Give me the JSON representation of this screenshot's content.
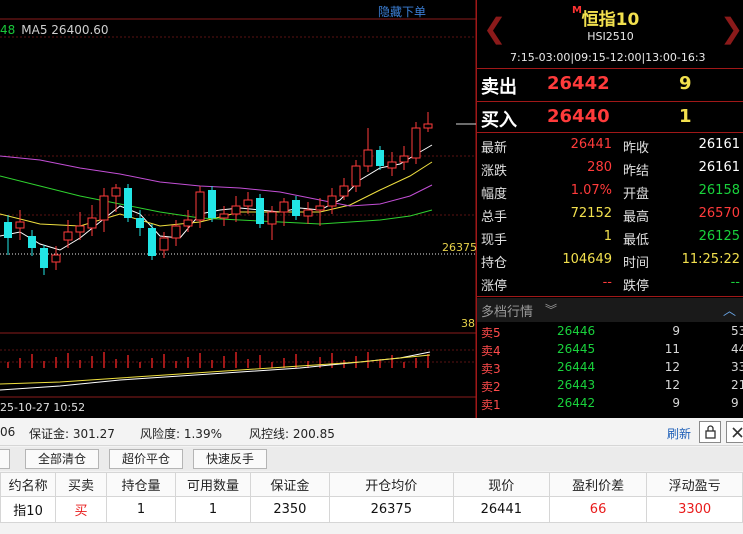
{
  "chart": {
    "hide_link": "隐藏下单",
    "ma_legend_num": "48",
    "ma_legend_text": "MA5 26400.60",
    "price_tag_main": "26375",
    "price_tag_sub": "38",
    "date_label": "25-10-27 10:52",
    "colors": {
      "up": "#ff3b3b",
      "down": "#22e6e6",
      "ma_white": "#ffffff",
      "ma_yellow": "#f0e040",
      "ma_purple": "#c34fd6",
      "ma_green": "#2fd12f"
    }
  },
  "quote": {
    "title": "恒指10",
    "market_flag": "M",
    "code": "HSI2510",
    "hours": "7:15-03:00|09:15-12:00|13:00-16:3",
    "sell": {
      "label": "卖出",
      "price": "26442",
      "volume": "9"
    },
    "buy": {
      "label": "买入",
      "price": "26440",
      "volume": "1"
    },
    "stats": [
      {
        "l1": "最新",
        "v1": "26441",
        "c1": "#ff3b3b",
        "l2": "昨收",
        "v2": "26161",
        "c2": "#ffffff"
      },
      {
        "l1": "涨跌",
        "v1": "280",
        "c1": "#ff3b3b",
        "l2": "昨结",
        "v2": "26161",
        "c2": "#ffffff"
      },
      {
        "l1": "幅度",
        "v1": "1.07%",
        "c1": "#ff3b3b",
        "l2": "开盘",
        "v2": "26158",
        "c2": "#19d23c"
      },
      {
        "l1": "总手",
        "v1": "72152",
        "c1": "#f2e04e",
        "l2": "最高",
        "v2": "26570",
        "c2": "#ff3b3b"
      },
      {
        "l1": "现手",
        "v1": "1",
        "c1": "#f2e04e",
        "l2": "最低",
        "v2": "26125",
        "c2": "#19d23c"
      },
      {
        "l1": "持仓",
        "v1": "104649",
        "c1": "#f2e04e",
        "l2": "时间",
        "v2": "11:25:22",
        "c2": "#f2e04e"
      },
      {
        "l1": "涨停",
        "v1": "--",
        "c1": "#ff3b3b",
        "l2": "跌停",
        "v2": "--",
        "c2": "#19d23c"
      }
    ],
    "depth_title": "多档行情",
    "depth": [
      {
        "label": "卖5",
        "price": "26446",
        "vol": "9",
        "vol2": "53"
      },
      {
        "label": "卖4",
        "price": "26445",
        "vol": "11",
        "vol2": "44"
      },
      {
        "label": "卖3",
        "price": "26444",
        "vol": "12",
        "vol2": "33"
      },
      {
        "label": "卖2",
        "price": "26443",
        "vol": "12",
        "vol2": "21"
      },
      {
        "label": "卖1",
        "price": "26442",
        "vol": "9",
        "vol2": "9"
      }
    ]
  },
  "account": {
    "left_fragment": "06",
    "margin": "保证金: 301.27",
    "risk": "风险度: 1.39%",
    "risk_line": "风控线: 200.85",
    "refresh": "刷新"
  },
  "actions": {
    "b0": "",
    "close_all": "全部清仓",
    "super_close": "超价平仓",
    "reverse": "快速反手"
  },
  "positions": {
    "headers": [
      "约名称",
      "买卖",
      "持仓量",
      "可用数量",
      "保证金",
      "开仓均价",
      "现价",
      "盈利价差",
      "浮动盈亏"
    ],
    "rows": [
      [
        "指10",
        "买",
        "1",
        "1",
        "2350",
        "26375",
        "26441",
        "66",
        "3300"
      ]
    ]
  }
}
